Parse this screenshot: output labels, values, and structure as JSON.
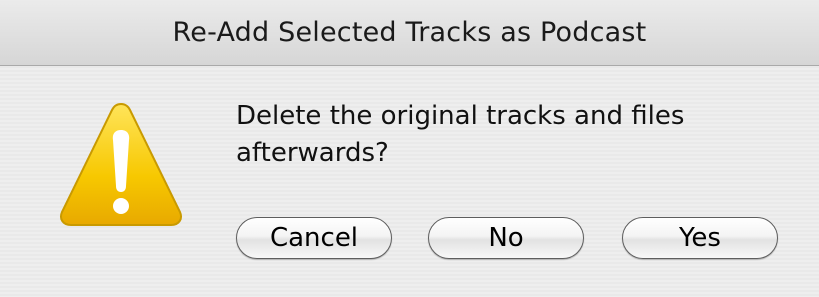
{
  "window": {
    "title": "Re-Add Selected Tracks as Podcast"
  },
  "alert": {
    "icon": "caution-icon",
    "message": "Delete the original tracks and files afterwards?"
  },
  "buttons": {
    "cancel_label": "Cancel",
    "no_label": "No",
    "yes_label": "Yes"
  },
  "colors": {
    "icon_fill": "#f5c200",
    "icon_mark": "#ffffff"
  }
}
